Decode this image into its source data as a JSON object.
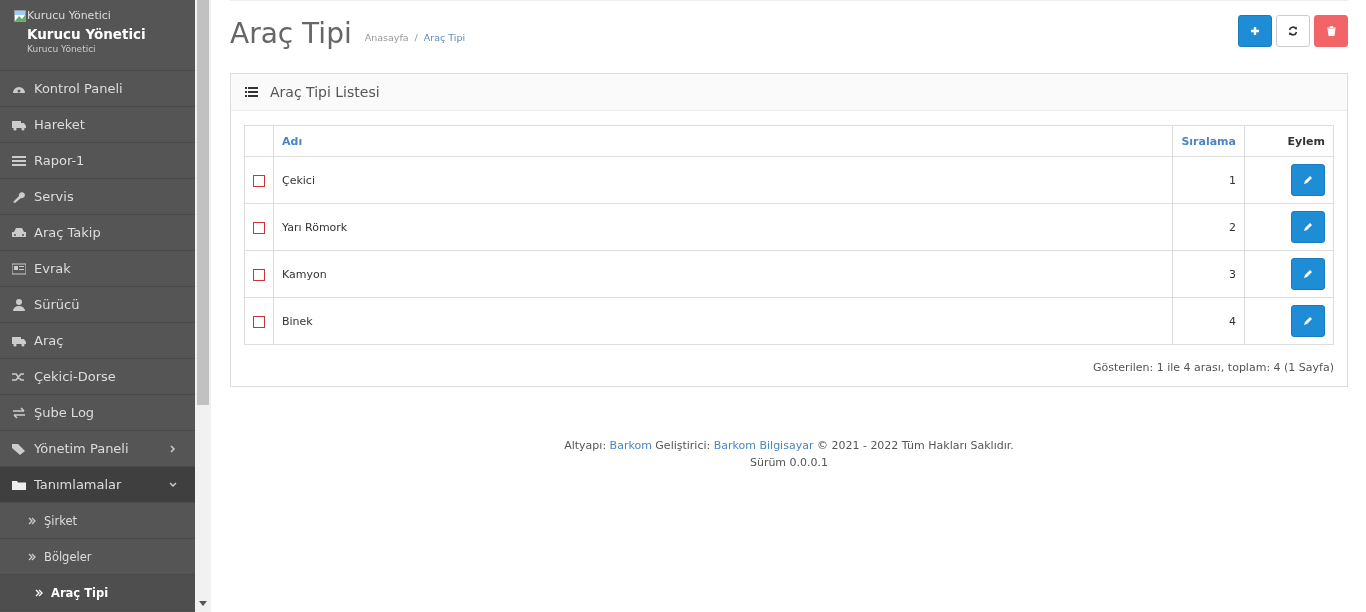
{
  "sidebar": {
    "profile": {
      "image_alt": "Kurucu Yönetici",
      "name": "Kurucu Yönetici",
      "role": "Kurucu Yönetici"
    },
    "items": [
      {
        "kind": "item",
        "label": "Kontrol Paneli"
      },
      {
        "kind": "item",
        "label": "Hareket"
      },
      {
        "kind": "item",
        "label": "Rapor-1"
      },
      {
        "kind": "item",
        "label": "Servis"
      },
      {
        "kind": "item",
        "label": "Araç Takip"
      },
      {
        "kind": "item",
        "label": "Evrak"
      },
      {
        "kind": "item",
        "label": "Sürücü"
      },
      {
        "kind": "item",
        "label": "Araç"
      },
      {
        "kind": "item",
        "label": "Çekici-Dorse"
      },
      {
        "kind": "item",
        "label": "Şube Log"
      },
      {
        "kind": "group",
        "label": "Yönetim Paneli",
        "expanded": false
      },
      {
        "kind": "group",
        "label": "Tanımlamalar",
        "expanded": true,
        "children": [
          {
            "label": "Şirket",
            "selected": false
          },
          {
            "label": "Bölgeler",
            "selected": false
          },
          {
            "label": "Araç Tipi",
            "selected": true
          }
        ]
      }
    ]
  },
  "page": {
    "title": "Araç Tipi",
    "breadcrumb": [
      "Anasayfa",
      "Araç Tipi"
    ],
    "separator": "/"
  },
  "panel": {
    "title": "Araç Tipi Listesi",
    "table": {
      "columns": [
        "Adı",
        "Sıralama",
        "Eylem"
      ],
      "rows": [
        {
          "checked": false,
          "name": "Çekici",
          "order": "1"
        },
        {
          "checked": false,
          "name": "Yarı Römork",
          "order": "2"
        },
        {
          "checked": false,
          "name": "Kamyon",
          "order": "3"
        },
        {
          "checked": false,
          "name": "Binek",
          "order": "4"
        }
      ]
    },
    "summary": "Gösterilen: 1 ile 4 arası, toplam: 4 (1 Sayfa)"
  },
  "footer": {
    "parts": [
      {
        "kind": "text",
        "text": "Altyapı:"
      },
      {
        "kind": "link",
        "text": "Barkom"
      },
      {
        "kind": "text",
        "text": "Geliştirici:"
      },
      {
        "kind": "link",
        "text": "Barkom Bilgisayar"
      },
      {
        "kind": "text",
        "text": "© 2021 - 2022 Tüm Hakları Saklıdır."
      }
    ],
    "version": "Sürüm 0.0.0.1"
  }
}
